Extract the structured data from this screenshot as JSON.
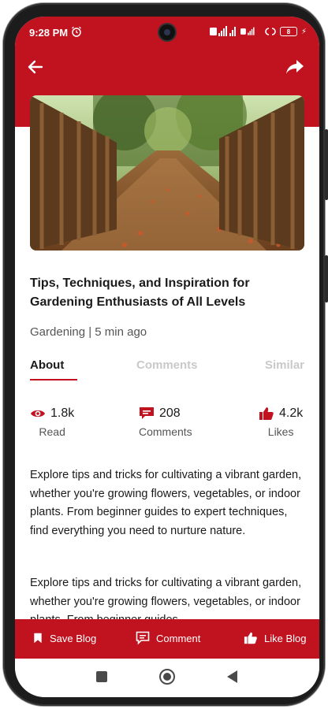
{
  "status_bar": {
    "time": "9:28 PM",
    "battery": "8"
  },
  "article": {
    "title": "Tips, Techniques, and Inspiration for Gardening Enthusiasts of All Levels",
    "category": "Gardening",
    "read_time": "5 min ago",
    "meta": "Gardening | 5 min ago"
  },
  "tabs": [
    {
      "label": "About",
      "active": true
    },
    {
      "label": "Comments",
      "active": false
    },
    {
      "label": "Similar",
      "active": false
    }
  ],
  "stats": {
    "reads": {
      "value": "1.8k",
      "label": "Read"
    },
    "comments": {
      "value": "208",
      "label": "Comments"
    },
    "likes": {
      "value": "4.2k",
      "label": "Likes"
    }
  },
  "body": {
    "paragraph1": "Explore tips and tricks for cultivating a vibrant garden, whether you're growing flowers, vegetables, or indoor plants. From beginner guides to expert techniques, find everything you need to nurture nature.",
    "paragraph2": "Explore tips and tricks for cultivating a vibrant garden, whether you're growing flowers, vegetables, or indoor plants. From beginner guides"
  },
  "actions": {
    "save": "Save Blog",
    "comment": "Comment",
    "like": "Like Blog"
  },
  "colors": {
    "accent": "#c0131f",
    "text": "#1a1a1a",
    "muted": "#555555",
    "inactive_tab": "#c9c9c9"
  },
  "icons": [
    "back-arrow-icon",
    "share-icon",
    "eye-icon",
    "comment-icon",
    "thumbs-up-icon",
    "bookmark-icon"
  ]
}
